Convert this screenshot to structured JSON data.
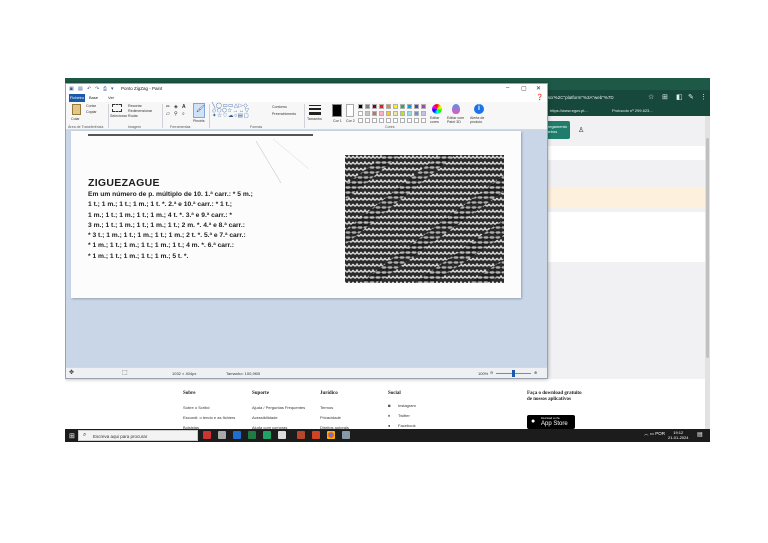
{
  "browser": {
    "url": "...scr%2C\"platform\"%3A\"web\"%7D",
    "bookmarks": [
      "https://www.egov.pt...",
      "Protocolo nº 299.623..."
    ],
    "page_button": "...carregamento\n...ficheiros",
    "footer": {
      "columns": [
        {
          "title": "Sobre",
          "links": [
            "Sobre o Scribd",
            "Escundi: o tendo e as fichiers",
            "Bolsistas"
          ]
        },
        {
          "title": "Suporte",
          "links": [
            "Ajuda / Perguntas Frequentes",
            "Acessibilidade",
            "Ajuda com compras"
          ]
        },
        {
          "title": "Jurídico",
          "links": [
            "Termos",
            "Privacidade",
            "Direitos autorais"
          ]
        },
        {
          "title": "Social",
          "links": [
            "Instagram",
            "Twitter",
            "Facebook"
          ]
        }
      ],
      "download_title": "Faça o download gratuito de nossos aplicativos",
      "appstore_small": "Download on the",
      "appstore_big": "App Store"
    }
  },
  "paint": {
    "title": "Ponto ZigZag - Paint",
    "menus": {
      "file": "Ficheiro",
      "home": "Base",
      "view": "Ver"
    },
    "ribbon": {
      "paste": "Colar",
      "cut": "Cortar",
      "copy": "Copiar",
      "select": "Selecionar",
      "crop": "Recortar",
      "resize": "Redimensionar",
      "rotate": "Rodar",
      "brushes": "Pincéis",
      "outline": "Contorno",
      "fill": "Preenchimento",
      "size": "Tamanho",
      "color1": "Cor 1",
      "color2": "Cor 2",
      "edit_colors": "Editar cores",
      "edit_paint3d": "Editar com Paint 3D",
      "product_alert": "Alerta de produto",
      "groups": [
        "Área de Transferência",
        "Imagem",
        "Ferramentas",
        "Formas",
        "Cores"
      ]
    },
    "canvas": {
      "heading": "ZIGUEZAGUE",
      "lines": [
        "Em um número de p. múltiplo de 10. 1.ª carr.: * 5 m.;",
        "1 t.; 1 m.; 1 t.; 1 m.; 1 t. *. 2.ª e 10.ª carr.: * 1 t.;",
        "1 m.; 1 t.; 1 m.; 1 t.; 1 m.; 4 t. *. 3.ª e 9.ª carr.: *",
        "3 m.; 1 t.; 1 m.; 1 t.; 1 m.; 1 t.; 2 m. *. 4.ª e 8.ª carr.:",
        "* 3 t.; 1 m.; 1 t.; 1 m.; 1 t.; 1 m.; 2 t. *. 5.ª e 7.ª carr.:",
        "* 1 m.; 1 t.; 1 m.; 1 t.; 1 m.; 1 t.; 4 m. *. 6.ª carr.:",
        "* 1 m.; 1 t.; 1 m.; 1 t.; 1 m.; 5 t. *."
      ]
    },
    "status": {
      "dimensions": "1032 × 404px",
      "size": "Tamanho: 100,9KB",
      "zoom": "100%"
    }
  },
  "taskbar": {
    "search_placeholder": "Escreva aqui para procurar",
    "language": "POR",
    "time": "19:12",
    "date": "21-01-2024"
  },
  "palette": [
    "#000000",
    "#7f7f7f",
    "#880015",
    "#ed1c24",
    "#ff7f27",
    "#fff200",
    "#22b14c",
    "#00a2e8",
    "#3f48cc",
    "#a349a4",
    "#ffffff",
    "#c3c3c3",
    "#b97a57",
    "#ffaec9",
    "#ffc90e",
    "#efe4b0",
    "#b5e61d",
    "#99d9ea",
    "#7092be",
    "#c8bfe7"
  ]
}
